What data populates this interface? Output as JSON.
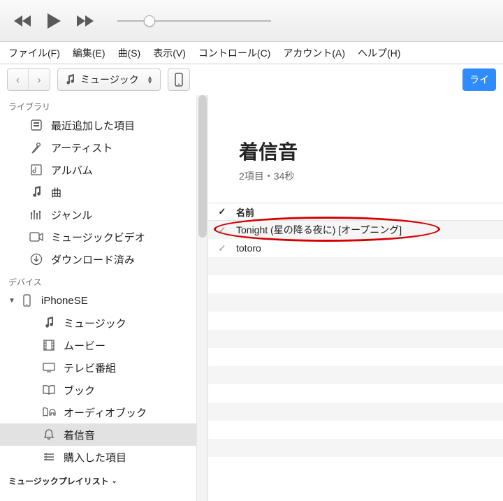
{
  "menubar": [
    "ファイル(F)",
    "編集(E)",
    "曲(S)",
    "表示(V)",
    "コントロール(C)",
    "アカウント(A)",
    "ヘルプ(H)"
  ],
  "toolbar": {
    "category": "ミュージック",
    "blue": "ライ"
  },
  "sidebar": {
    "library_label": "ライブラリ",
    "library": [
      {
        "icon": "recent",
        "label": "最近追加した項目"
      },
      {
        "icon": "artist",
        "label": "アーティスト"
      },
      {
        "icon": "album",
        "label": "アルバム"
      },
      {
        "icon": "song",
        "label": "曲"
      },
      {
        "icon": "genre",
        "label": "ジャンル"
      },
      {
        "icon": "mvideo",
        "label": "ミュージックビデオ"
      },
      {
        "icon": "download",
        "label": "ダウンロード済み"
      }
    ],
    "devices_label": "デバイス",
    "device_name": "iPhoneSE",
    "device_children": [
      {
        "icon": "song",
        "label": "ミュージック"
      },
      {
        "icon": "movie",
        "label": "ムービー"
      },
      {
        "icon": "tv",
        "label": "テレビ番組"
      },
      {
        "icon": "book",
        "label": "ブック"
      },
      {
        "icon": "audiobook",
        "label": "オーディオブック"
      },
      {
        "icon": "ringtone",
        "label": "着信音",
        "selected": true
      },
      {
        "icon": "purchased",
        "label": "購入した項目"
      }
    ],
    "playlists_label": "ミュージックプレイリスト"
  },
  "main": {
    "title": "着信音",
    "subtitle": "2項目・34秒",
    "col_checked": "✓",
    "col_name": "名前",
    "rows": [
      {
        "checked": true,
        "name": "Tonight (星の降る夜に) [オープニング]",
        "circled": true
      },
      {
        "checked": true,
        "name": "totoro"
      }
    ]
  }
}
